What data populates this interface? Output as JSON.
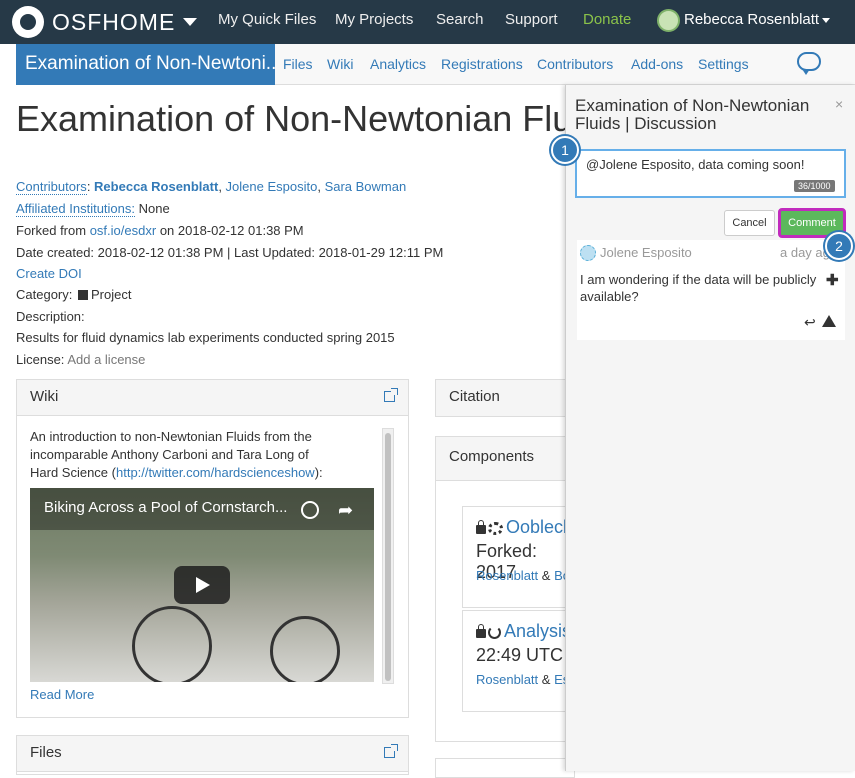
{
  "topnav": {
    "brand": "OSFHOME",
    "links": [
      "My Quick Files",
      "My Projects",
      "Search",
      "Support",
      "Donate"
    ],
    "user": "Rebecca Rosenblatt",
    "donate_color": "#8bc34a"
  },
  "projnav": {
    "title": "Examination of Non-Newtoni...",
    "tabs": [
      "Files",
      "Wiki",
      "Analytics",
      "Registrations",
      "Contributors",
      "Add-ons",
      "Settings"
    ]
  },
  "project": {
    "title": "Examination of Non-Newtonian Fluids",
    "contributors_label": "Contributors",
    "contributors": [
      "Rebecca Rosenblatt",
      "Jolene Esposito",
      "Sara Bowman"
    ],
    "institutions_label": "Affiliated Institutions:",
    "institutions_value": "None",
    "forked_prefix": "Forked from",
    "forked_link": "osf.io/esdxr",
    "forked_suffix": "on 2018-02-12 01:38 PM",
    "dates": "Date created: 2018-02-12 01:38 PM | Last Updated: 2018-01-29 12:11 PM",
    "create_doi": "Create DOI",
    "category_label": "Category:",
    "category_value": "Project",
    "description_label": "Description:",
    "description": "Results for fluid dynamics lab experiments conducted spring 2015",
    "license_label": "License:",
    "license_value": "Add a license"
  },
  "wiki": {
    "heading": "Wiki",
    "text_before": "An introduction to non-Newtonian Fluids from the incomparable Anthony Carboni and Tara Long of Hard Science (",
    "link": "http://twitter.com/hardscienceshow",
    "text_after": "):",
    "video_title": "Biking Across a Pool of Cornstarch...",
    "read_more": "Read More"
  },
  "files_panel": {
    "heading": "Files"
  },
  "citation": {
    "heading": "Citation"
  },
  "components": {
    "heading": "Components",
    "items": [
      {
        "title": "Oobleck",
        "sub": "Forked: 2017",
        "auth1": "Rosenblatt",
        "amp": "&",
        "auth2": "Bo"
      },
      {
        "title": "Analysis",
        "sub": "22:49 UTC",
        "auth1": "Rosenblatt",
        "amp": "&",
        "auth2": "Esp"
      }
    ]
  },
  "discussion": {
    "title": "Examination of Non-Newtonian Fluids | Discussion",
    "close": "×",
    "draft": "@Jolene Esposito, data coming soon!",
    "char_count": "36/1000",
    "cancel": "Cancel",
    "comment": "Comment",
    "comment_item": {
      "author": "Jolene Esposito",
      "time": "a day ago",
      "text": "I am wondering if the data will be publicly available?"
    }
  },
  "steps": [
    "1",
    "2"
  ]
}
